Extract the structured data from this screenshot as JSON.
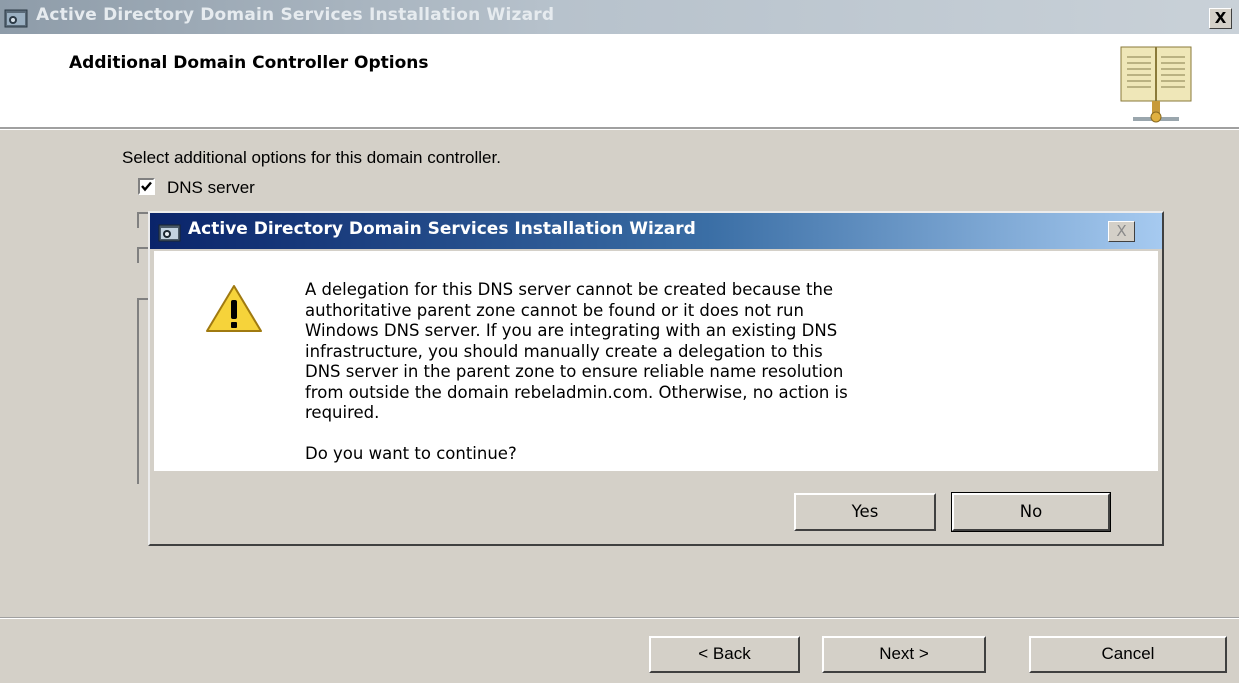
{
  "wizard": {
    "title": "Active Directory Domain Services Installation Wizard",
    "close_label": "X",
    "header_title": "Additional Domain Controller Options",
    "instruction": "Select additional options for this domain controller.",
    "options": [
      {
        "label": "DNS server",
        "checked": true
      }
    ],
    "buttons": {
      "back": "< Back",
      "next": "Next >",
      "cancel": "Cancel"
    }
  },
  "dialog": {
    "title": "Active Directory Domain Services Installation Wizard",
    "close_label": "X",
    "message": "A delegation for this DNS server cannot be created because the\nauthoritative parent zone cannot be found or it does not run\nWindows DNS server. If you are integrating with an existing DNS\ninfrastructure, you should manually create a delegation to this\nDNS server in the parent zone to ensure reliable name resolution\nfrom outside the domain rebeladmin.com. Otherwise, no action is\nrequired.",
    "question": "Do you want to continue?",
    "buttons": {
      "yes": "Yes",
      "no": "No"
    }
  },
  "colors": {
    "dialog_title_start": "#0a246a",
    "dialog_title_end": "#a6caf0",
    "window_face": "#d4d0c8"
  },
  "icons": [
    "app-icon",
    "book-icon",
    "warning-icon",
    "close-icon",
    "checkmark-icon"
  ]
}
